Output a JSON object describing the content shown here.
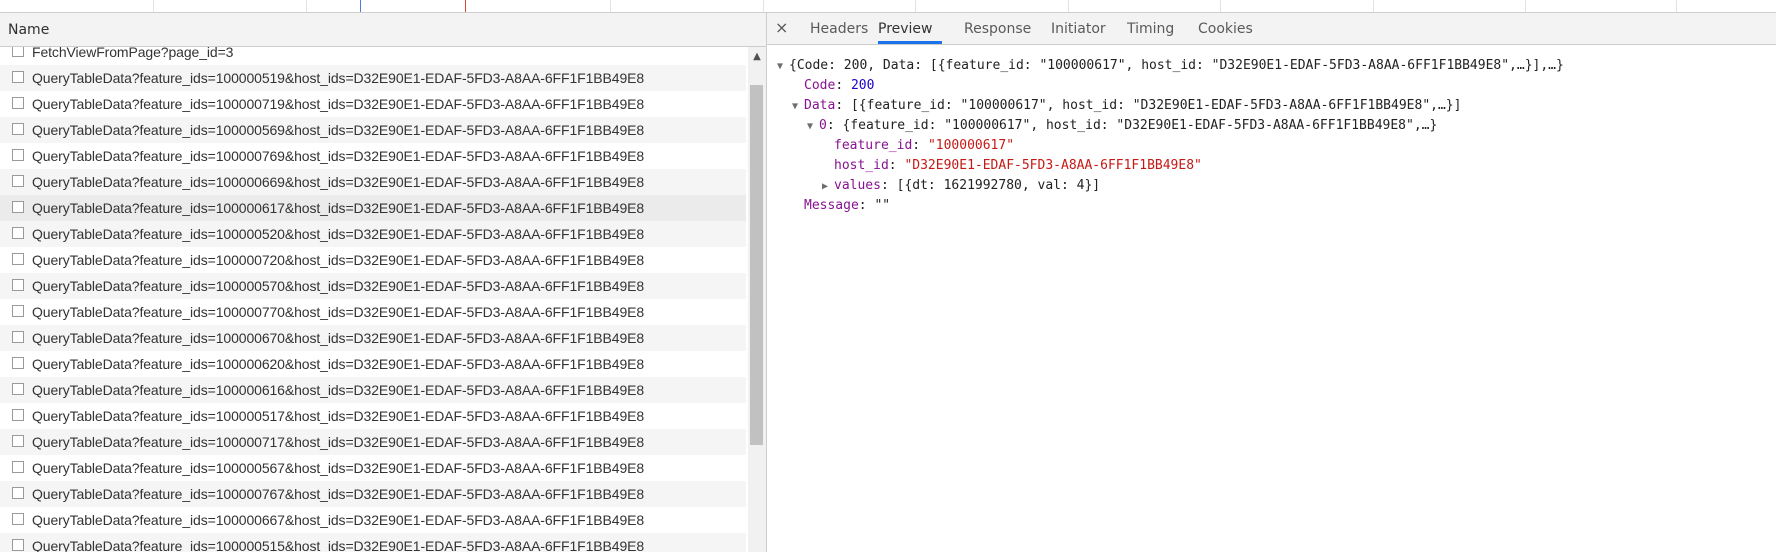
{
  "network_list": {
    "header": "Name",
    "rows": [
      "FetchViewFromPage?page_id=3",
      "QueryTableData?feature_ids=100000519&host_ids=D32E90E1-EDAF-5FD3-A8AA-6FF1F1BB49E8",
      "QueryTableData?feature_ids=100000719&host_ids=D32E90E1-EDAF-5FD3-A8AA-6FF1F1BB49E8",
      "QueryTableData?feature_ids=100000569&host_ids=D32E90E1-EDAF-5FD3-A8AA-6FF1F1BB49E8",
      "QueryTableData?feature_ids=100000769&host_ids=D32E90E1-EDAF-5FD3-A8AA-6FF1F1BB49E8",
      "QueryTableData?feature_ids=100000669&host_ids=D32E90E1-EDAF-5FD3-A8AA-6FF1F1BB49E8",
      "QueryTableData?feature_ids=100000617&host_ids=D32E90E1-EDAF-5FD3-A8AA-6FF1F1BB49E8",
      "QueryTableData?feature_ids=100000520&host_ids=D32E90E1-EDAF-5FD3-A8AA-6FF1F1BB49E8",
      "QueryTableData?feature_ids=100000720&host_ids=D32E90E1-EDAF-5FD3-A8AA-6FF1F1BB49E8",
      "QueryTableData?feature_ids=100000570&host_ids=D32E90E1-EDAF-5FD3-A8AA-6FF1F1BB49E8",
      "QueryTableData?feature_ids=100000770&host_ids=D32E90E1-EDAF-5FD3-A8AA-6FF1F1BB49E8",
      "QueryTableData?feature_ids=100000670&host_ids=D32E90E1-EDAF-5FD3-A8AA-6FF1F1BB49E8",
      "QueryTableData?feature_ids=100000620&host_ids=D32E90E1-EDAF-5FD3-A8AA-6FF1F1BB49E8",
      "QueryTableData?feature_ids=100000616&host_ids=D32E90E1-EDAF-5FD3-A8AA-6FF1F1BB49E8",
      "QueryTableData?feature_ids=100000517&host_ids=D32E90E1-EDAF-5FD3-A8AA-6FF1F1BB49E8",
      "QueryTableData?feature_ids=100000717&host_ids=D32E90E1-EDAF-5FD3-A8AA-6FF1F1BB49E8",
      "QueryTableData?feature_ids=100000567&host_ids=D32E90E1-EDAF-5FD3-A8AA-6FF1F1BB49E8",
      "QueryTableData?feature_ids=100000767&host_ids=D32E90E1-EDAF-5FD3-A8AA-6FF1F1BB49E8",
      "QueryTableData?feature_ids=100000667&host_ids=D32E90E1-EDAF-5FD3-A8AA-6FF1F1BB49E8",
      "QueryTableData?feature_ids=100000515&host_ids=D32E90E1-EDAF-5FD3-A8AA-6FF1F1BB49E8"
    ],
    "selected_row": "QueryTableData?feature_ids=100000617&host_ids=D32E90E1-EDAF-5FD3-A8AA-6FF1F1BB49E8"
  },
  "detail_tabs": {
    "close_icon": "close-icon",
    "close_glyph": "×",
    "tabs": [
      "Headers",
      "Preview",
      "Response",
      "Initiator",
      "Timing",
      "Cookies"
    ],
    "active": "Preview"
  },
  "preview": {
    "root_summary": "{Code: 200, Data: [{feature_id: \"100000617\", host_id: \"D32E90E1-EDAF-5FD3-A8AA-6FF1F1BB49E8\",…}],…}",
    "code_key": "Code",
    "code_value": "200",
    "data_key": "Data",
    "data_summary": "[{feature_id: \"100000617\", host_id: \"D32E90E1-EDAF-5FD3-A8AA-6FF1F1BB49E8\",…}]",
    "item_key": "0",
    "item_summary": "{feature_id: \"100000617\", host_id: \"D32E90E1-EDAF-5FD3-A8AA-6FF1F1BB49E8\",…}",
    "feature_id_key": "feature_id",
    "feature_id_value": "\"100000617\"",
    "host_id_key": "host_id",
    "host_id_value": "\"D32E90E1-EDAF-5FD3-A8AA-6FF1F1BB49E8\"",
    "values_key": "values",
    "values_summary": "[{dt: 1621992780, val: 4}]",
    "message_key": "Message",
    "message_value": "\"\"",
    "colon": ":"
  },
  "colors": {
    "accent": "#1a73e8",
    "key": "#881391",
    "number": "#1c00cf",
    "string": "#c41a16"
  }
}
